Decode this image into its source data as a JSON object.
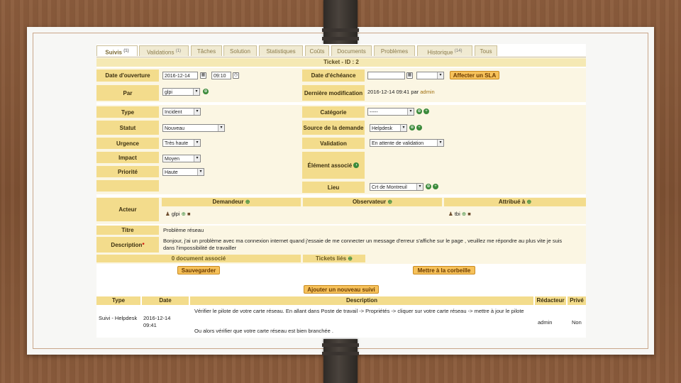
{
  "tabs": [
    {
      "label": "Suivis",
      "count": "(1)",
      "active": true
    },
    {
      "label": "Validations",
      "count": "(1)"
    },
    {
      "label": "Tâches",
      "count": ""
    },
    {
      "label": "Solution",
      "count": ""
    },
    {
      "label": "Statistiques",
      "count": ""
    },
    {
      "label": "Coûts",
      "count": ""
    },
    {
      "label": "Documents",
      "count": ""
    },
    {
      "label": "Problèmes",
      "count": ""
    },
    {
      "label": "Historique",
      "count": "(14)"
    },
    {
      "label": "Tous",
      "count": ""
    }
  ],
  "ticket_title": "Ticket - ID : 2",
  "left": {
    "date_ouverture_label": "Date d'ouverture",
    "date_ouverture_value": "2016-12-14",
    "heure_ouverture_value": "09:10",
    "par_label": "Par",
    "par_value": "glpi",
    "type_label": "Type",
    "type_value": "Incident",
    "statut_label": "Statut",
    "statut_value": "Nouveau",
    "urgence_label": "Urgence",
    "urgence_value": "Très haute",
    "impact_label": "Impact",
    "impact_value": "Moyen",
    "priorite_label": "Priorité",
    "priorite_value": "Haute"
  },
  "right": {
    "date_echeance_label": "Date d'échéance",
    "affecter_sla_label": "Affecter un SLA",
    "derniere_modif_label": "Dernière modification",
    "derniere_modif_value": "2016-12-14 09:41",
    "derniere_modif_par": "par",
    "derniere_modif_user": "admin",
    "categorie_label": "Catégorie",
    "categorie_value": "-----",
    "source_label": "Source de la demande",
    "source_value": "Helpdesk",
    "validation_label": "Validation",
    "validation_value": "En attente de validation",
    "element_label": "Élément associé",
    "lieu_label": "Lieu",
    "lieu_value": "Crt de Montreuil"
  },
  "acteur": {
    "label": "Acteur",
    "demandeur_label": "Demandeur",
    "demandeur_user": "glpi",
    "observateur_label": "Observateur",
    "attribue_label": "Attribué à",
    "attribue_user": "tbi"
  },
  "titre_label": "Titre",
  "titre_value": "Problème réseau",
  "description_label": "Description",
  "description_required": "*",
  "description_value": "Bonjour, j'ai un problème avec ma connexion internet quand j'essaie de me connecter un message d'erreur s'affiche sur le page , veuillez me répondre au plus vite je suis dans l'impossibilité de travailler",
  "documents_label": "0 document associé",
  "tickets_lies_label": "Tickets liés",
  "save_button": "Sauvegarder",
  "trash_button": "Mettre à la corbeille",
  "add_followup_button": "Ajouter un nouveau suivi",
  "followups": {
    "headers": [
      "Type",
      "Date",
      "Description",
      "Rédacteur",
      "Privé"
    ],
    "rows": [
      {
        "type": "Suivi - Helpdesk",
        "date": "2016-12-14 09:41",
        "description_1": "Vérifier le pilote de votre carte réseau. En allant dans Poste de travail -> Propriétés -> cliquer sur votre carte réseau -> mettre à jour le pilote",
        "description_2": "Ou alors vérifier que votre carte réseau est bien branchée .",
        "author": "admin",
        "private": "Non"
      }
    ]
  },
  "colors": {
    "label_bg": "#f3dc8c",
    "button_bg": "#f6c15a",
    "tab_bg": "#f0ead2"
  }
}
